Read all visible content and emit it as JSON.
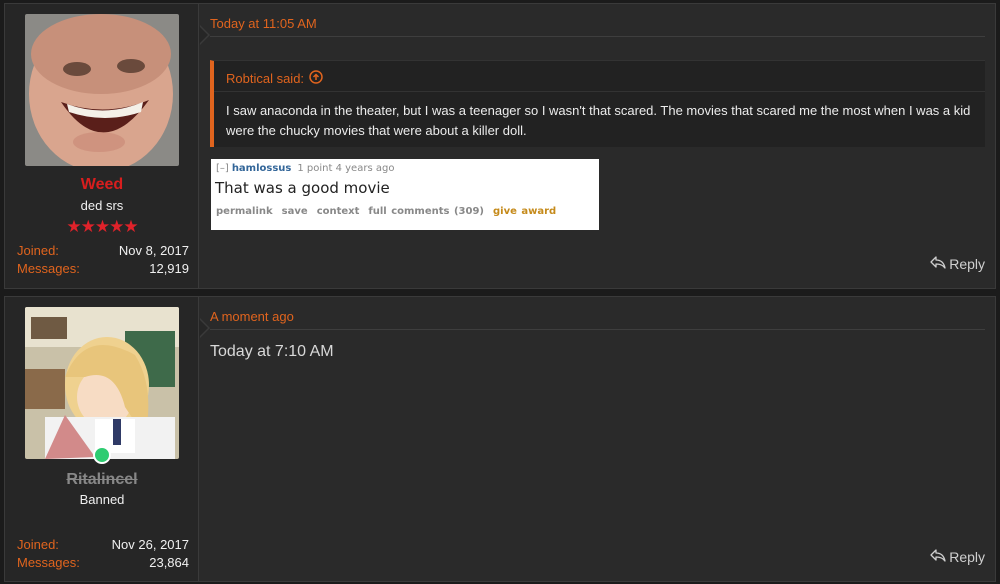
{
  "posts": [
    {
      "user": {
        "name": "Weed",
        "title": "ded srs",
        "stars": "★★★★★",
        "joined_label": "Joined:",
        "joined_value": "Nov 8, 2017",
        "messages_label": "Messages:",
        "messages_value": "12,919",
        "name_color": "#d81e1e"
      },
      "timestamp": "Today at 11:05 AM",
      "quote": {
        "author": "Robtical said:",
        "text": "I saw anaconda in the theater, but I was a teenager so I wasn't that scared. The movies that scared me the most when I was a kid were the chucky movies that were about a killer doll."
      },
      "embed": {
        "collapse": "[–]",
        "username": "hamlossus",
        "meta": "1 point 4 years ago",
        "body": "That was a good movie",
        "actions": [
          "permalink",
          "save",
          "context",
          "full comments (309)"
        ],
        "award": "give award"
      },
      "reply_label": "Reply"
    },
    {
      "user": {
        "name": "Ritalincel",
        "title": "Banned",
        "joined_label": "Joined:",
        "joined_value": "Nov 26, 2017",
        "messages_label": "Messages:",
        "messages_value": "23,864",
        "name_color": "#888888"
      },
      "timestamp": "A moment ago",
      "body": "Today at 7:10 AM",
      "reply_label": "Reply"
    }
  ],
  "colors": {
    "accent": "#e0641e",
    "background": "#2a2a2a",
    "star": "#e0222a",
    "online": "#2ecc71"
  },
  "icons": {
    "quote_jump": "circle-arrow-up-icon",
    "reply": "reply-arrow-icon",
    "online": "online-status-dot"
  }
}
